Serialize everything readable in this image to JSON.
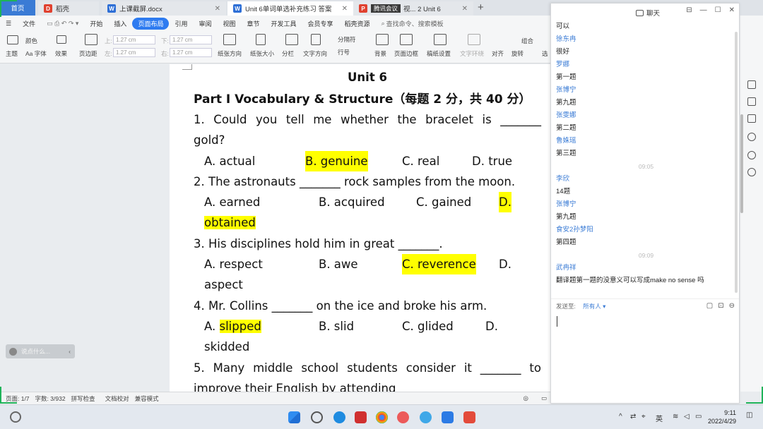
{
  "tabs": [
    {
      "label": "首页"
    },
    {
      "label": "稻壳"
    },
    {
      "label": "上课截屏.docx"
    },
    {
      "label": "Unit 6单词单选补充练习 答案"
    },
    {
      "label": "腾讯会议"
    },
    {
      "label": "视... 2 Unit 6"
    }
  ],
  "menu": {
    "file": "文件",
    "items": [
      "开始",
      "插入",
      "页面布局",
      "引用",
      "审阅",
      "视图",
      "章节",
      "开发工具",
      "会员专享",
      "稻壳资源"
    ],
    "active": "页面布局",
    "search": "查找命令、搜索模板"
  },
  "toolbar": {
    "theme": "主题",
    "colors": "颜色",
    "fonts": "Aa 字体",
    "effects": "效果",
    "margins": "页边距",
    "top_label": "上:",
    "top_val": "1.27 cm",
    "bottom_label": "下:",
    "bottom_val": "1.27 cm",
    "left_label": "左:",
    "left_val": "1.27 cm",
    "right_label": "右:",
    "right_val": "1.27 cm",
    "orientation": "纸张方向",
    "size": "纸张大小",
    "columns": "分栏",
    "text_dir": "文字方向",
    "separator": "分隔符",
    "line_num": "行号",
    "background": "背景",
    "page_border": "页面边框",
    "draft_setting": "稿纸设置",
    "text_wrap": "文字环绕",
    "align": "对齐",
    "rotate": "旋转",
    "select": "选",
    "group": "组合"
  },
  "document": {
    "title": "Unit 6",
    "heading": "Part I Vocabulary & Structure（每题 2 分，共 40 分）",
    "q1_line1": [
      "1.",
      "Could",
      "you",
      "tell",
      "me",
      "whether",
      "the",
      "bracelet",
      "is",
      "_______"
    ],
    "q1_line2": "gold?",
    "q1_opts": [
      "A.  actual",
      "B. genuine",
      "C. real",
      "D. true"
    ],
    "q2": "2.  The astronauts _______ rock samples from the moon.",
    "q2_opts": [
      "A.  earned",
      "B. acquired",
      "C. gained",
      "D."
    ],
    "q2_wrap": "obtained",
    "q3": "3.  His disciplines hold him in great _______.",
    "q3_opts": [
      "A.  respect",
      "B. awe",
      "C. reverence",
      "D."
    ],
    "q3_wrap": "aspect",
    "q4": "4.  Mr. Collins _______ on the ice and broke his arm.",
    "q4_opts": [
      "A.  ",
      "slipped ",
      "B. slid",
      "C. glided",
      "D."
    ],
    "q4_wrap": "skidded",
    "q5_line1": [
      "5.",
      "Many",
      "middle",
      "school",
      "students",
      "consider",
      "it",
      "_______",
      "to"
    ],
    "q5_line2": "improve their English by attending"
  },
  "speak_widget": "说点什么...",
  "status": {
    "page": "页面: 1/7",
    "words": "字数: 3/932",
    "spell": "拼写检查",
    "proof": "文档校对",
    "compat": "兼容模式"
  },
  "chat": {
    "title": "聊天",
    "messages": [
      {
        "kind": "text",
        "text": "可以"
      },
      {
        "kind": "name",
        "text": "徐东冉"
      },
      {
        "kind": "text",
        "text": "很好"
      },
      {
        "kind": "name",
        "text": "罗娜"
      },
      {
        "kind": "text",
        "text": "第一题"
      },
      {
        "kind": "name",
        "text": "张博宁"
      },
      {
        "kind": "text",
        "text": "第九题"
      },
      {
        "kind": "name",
        "text": "张雯娜"
      },
      {
        "kind": "text",
        "text": "第二题"
      },
      {
        "kind": "name",
        "text": "鲁姝瑶"
      },
      {
        "kind": "text",
        "text": "第三题"
      },
      {
        "kind": "time",
        "text": "09:05"
      },
      {
        "kind": "name",
        "text": "李欣"
      },
      {
        "kind": "text",
        "text": "14题"
      },
      {
        "kind": "name",
        "text": "张博宁"
      },
      {
        "kind": "text",
        "text": "第九题"
      },
      {
        "kind": "name",
        "text": "食安2孙梦阳"
      },
      {
        "kind": "text",
        "text": "第四题"
      },
      {
        "kind": "time",
        "text": "09:09"
      },
      {
        "kind": "name",
        "text": "武冉祥"
      },
      {
        "kind": "text",
        "text": "翻译题第一题的没意义可以写成make no sense 吗"
      }
    ],
    "send_to_label": "发送至:",
    "send_to_value": "所有人"
  },
  "clock": {
    "time": "9:11",
    "date": "2022/4/29"
  },
  "colors": {
    "accent": "#2e7bf0",
    "highlight": "#ffff00",
    "chat_name": "#3a7bd5",
    "frame_green": "#1fb35a"
  }
}
